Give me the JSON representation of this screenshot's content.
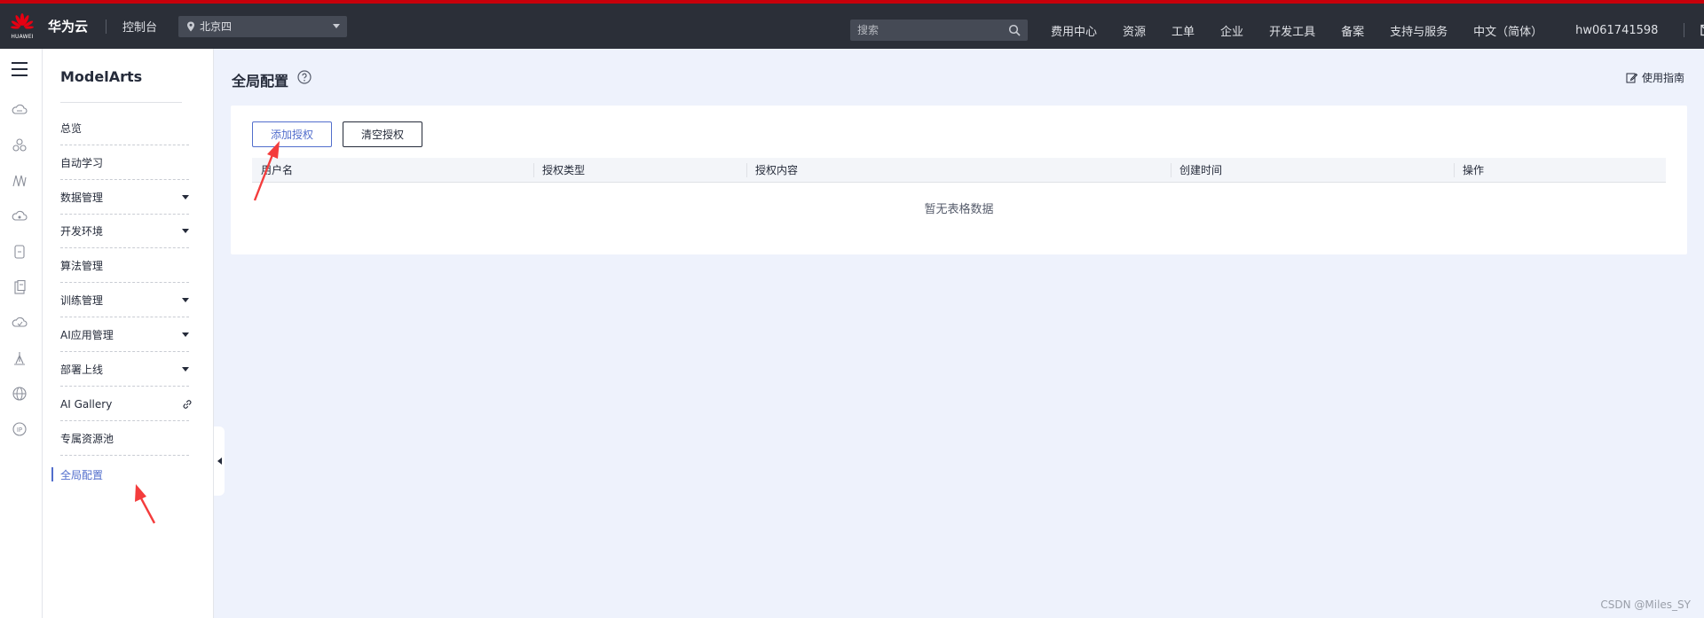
{
  "header": {
    "logo_text": "HUAWEI",
    "brand": "华为云",
    "console": "控制台",
    "region": "北京四",
    "search_placeholder": "搜索",
    "nav": [
      "费用中心",
      "资源",
      "工单",
      "企业",
      "开发工具",
      "备案",
      "支持与服务",
      "中文（简体）"
    ],
    "user": "hw061741598"
  },
  "rail_icons": [
    "cloud-icon",
    "cluster-icon",
    "algorithm-icon",
    "cloud-storage-icon",
    "database-icon",
    "document-icon",
    "cloud-icon",
    "tower-icon",
    "globe-icon",
    "ip-icon"
  ],
  "sidebar": {
    "title": "ModelArts",
    "items": [
      {
        "label": "总览",
        "expandable": false
      },
      {
        "label": "自动学习",
        "expandable": false
      },
      {
        "label": "数据管理",
        "expandable": true
      },
      {
        "label": "开发环境",
        "expandable": true
      },
      {
        "label": "算法管理",
        "expandable": false
      },
      {
        "label": "训练管理",
        "expandable": true
      },
      {
        "label": "AI应用管理",
        "expandable": true
      },
      {
        "label": "部署上线",
        "expandable": true
      },
      {
        "label": "AI Gallery",
        "expandable": false,
        "external_link": true
      },
      {
        "label": "专属资源池",
        "expandable": false
      },
      {
        "label": "全局配置",
        "expandable": false,
        "active": true
      }
    ]
  },
  "main": {
    "page_title": "全局配置",
    "guide_label": "使用指南",
    "add_button": "添加授权",
    "clear_button": "清空授权",
    "table": {
      "columns": [
        "用户名",
        "授权类型",
        "授权内容",
        "创建时间",
        "操作"
      ],
      "rows": [],
      "empty_text": "暂无表格数据"
    }
  },
  "watermark": "CSDN @Miles_SY",
  "colors": {
    "topbar": "#2b2f38",
    "top_accent": "#c7000b",
    "brand_accent": "#526ecc",
    "annotation_arrow": "#f43c3c",
    "page_background": "#eef2fc"
  }
}
